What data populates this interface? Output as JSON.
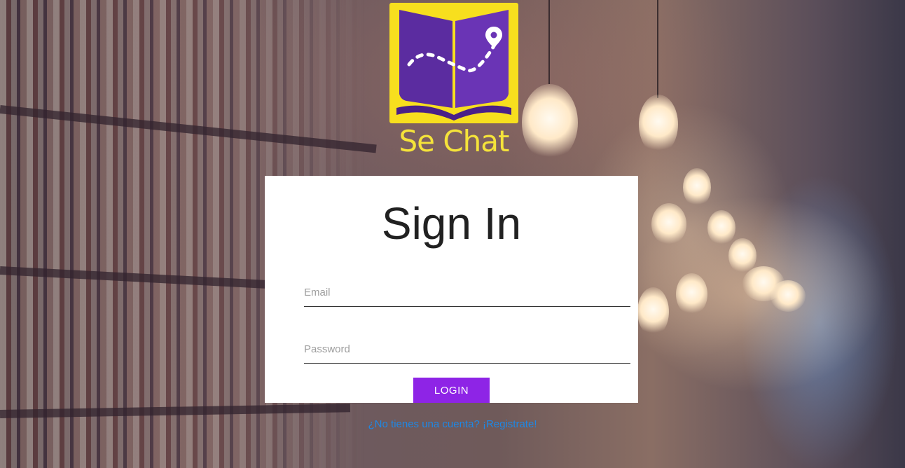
{
  "brand": {
    "name": "Se Chat",
    "colors": {
      "logo_background": "#f7df1e",
      "logo_book": "#5b2ca0",
      "logo_text": "#f5e33a"
    }
  },
  "signin": {
    "title": "Sign In",
    "email_placeholder": "Email",
    "password_placeholder": "Password",
    "login_label": "LOGIN",
    "login_color": "#8e24e6",
    "register_text": "¿No tienes una cuenta? ¡Registrate!",
    "register_color": "#1e88e5"
  },
  "icons": {
    "logo": "open-book-with-map-pin-icon"
  }
}
